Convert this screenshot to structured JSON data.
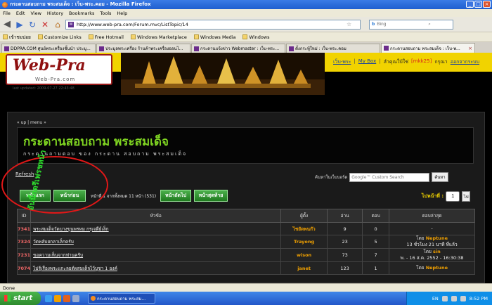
{
  "window": {
    "title": "กระดานสอบถาม พระสมเด็จ : เว็บ-พระ.คอม - Mozilla Firefox",
    "controls": [
      "_",
      "□",
      "×"
    ]
  },
  "menu": [
    "File",
    "Edit",
    "View",
    "History",
    "Bookmarks",
    "Tools",
    "Help"
  ],
  "nav": {
    "url": "http://www.web-pra.com/Forum.mvc/ListTopic/14",
    "search_placeholder": "Bing",
    "search_engine": "b"
  },
  "bookmarks": [
    "เข้าชมบ่อย",
    "Customize Links",
    "Free Hotmail",
    "Windows Marketplace",
    "Windows Media",
    "Windows"
  ],
  "tabs": [
    {
      "label": "DDPRA.COM ศูนย์พระเครื่องชั้นนำ ประมู...",
      "active": false
    },
    {
      "label": "ประมูลพระเครื่อง ร้านค้าพระเครื่องออนไ...",
      "active": false
    },
    {
      "label": "กระดานแจ้งข่าว Webmaster : เว็บ-พระ...",
      "active": false
    },
    {
      "label": "ตั้งกระทู้ใหม่ : เว็บ-พระ.คอม",
      "active": false
    },
    {
      "label": "กระดานสอบถาม พระสมเด็จ : เว็บ-พ...",
      "active": true
    }
  ],
  "site": {
    "logo_text": "Web-Pra",
    "logo_sub": "Web-Pra.com",
    "updated": "last updated: 2009-07-27 22:43:48",
    "links": {
      "home": "เว็บ-พระ",
      "mybox": "My Box",
      "login_prefix": "ลำคุณใบ้ใช่",
      "user": "[mkk25]",
      "logout_prefix": "กรุณา",
      "logout": "ออกจากระบบ"
    }
  },
  "breadcrumb": {
    "up": "« up",
    "menu": "menu »"
  },
  "forum": {
    "title": "กระดานสอบถาม พระสมเด็จ",
    "subtitle": "กระดานถามตอบ ของ กระดาน สอบถาม พระสมเด็จ"
  },
  "refresh": "Refresh",
  "site_search": {
    "label": "ค้นหาในเว็บบอร์ด",
    "placeholder": "Google™ Custom Search",
    "button": "ค้นหา"
  },
  "pager": {
    "first": "หน้าแรก",
    "prev": "หน้าก่อน",
    "info": "หน้าที่ 1 จากทั้งหมด 11 หน้า (531)",
    "next": "หน้าถัดไป",
    "last": "หน้าสุดท้าย",
    "goto_label": "ไปหน้าที่ :",
    "goto_value": "1",
    "goto_button": "ไป"
  },
  "table": {
    "headers": {
      "id": "ID",
      "topic": "หัวข้อ",
      "author": "ผู้ตั้ง",
      "reads": "อ่าน",
      "replies": "ตอบ",
      "last": "ตอบล่าสุด"
    },
    "rows": [
      {
        "id": "7341",
        "topic": "พระสมเด็จวัดบางขุนพรหม กรุเจดีย์เล็ก",
        "author": "ไชยัดพนก๊ว",
        "reads": "9",
        "replies": "0",
        "last_by": "",
        "last_who": "-",
        "last_time": ""
      },
      {
        "id": "7324",
        "topic": "วัดพลับยกลาเล็กครับ",
        "author": "Trayong",
        "reads": "23",
        "replies": "5",
        "last_by": "โดย",
        "last_who": "Neptune",
        "last_time": "13 ชั่วโมง 21 นาที ที่แล้ว"
      },
      {
        "id": "7231",
        "topic": "ขอความเห็นจากท่านครับ",
        "author": "wison",
        "reads": "73",
        "replies": "7",
        "last_by": "โดย",
        "last_who": "sin",
        "last_time": "พ. - 16 ส.ค. 2552 - 16:30:38"
      },
      {
        "id": "7074",
        "topic": "ไม่รู้เรื่องพระแกะลยต์ผสมเด็จไว้บูชา 1 องค์",
        "author": "janet",
        "reads": "123",
        "replies": "1",
        "last_by": "โดย",
        "last_who": "Neptune",
        "last_time": ""
      }
    ]
  },
  "annotation": {
    "text": "อันนี้กดรีเฟรชหน้า"
  },
  "status": "Done",
  "taskbar": {
    "start": "start",
    "window_item": "กระดานสอบถาม พระสม...",
    "lang": "EN",
    "clock": "8:52 PM"
  },
  "colors": {
    "header_yellow": "#f1d300",
    "forum_title_green": "#7ed321",
    "pager_green": "#2e8a2e",
    "author_orange": "#f0a000",
    "id_red": "#e66666",
    "annotation_red": "#e01818"
  }
}
